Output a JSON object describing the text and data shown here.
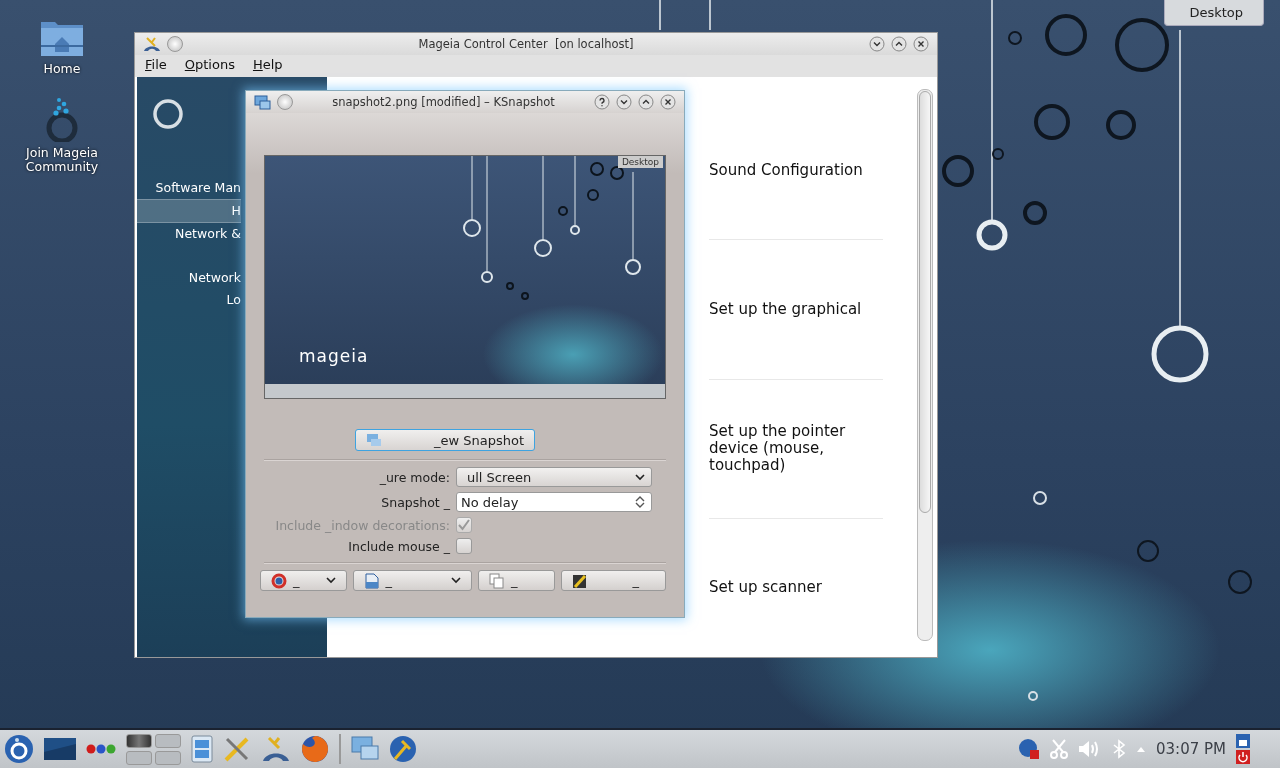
{
  "desktop_icons": [
    {
      "label": "Home",
      "kind": "folder"
    },
    {
      "label": "Join Mageia Community",
      "kind": "community"
    }
  ],
  "desktop_button": "Desktop",
  "control_center": {
    "title": "Mageia Control Center  [on localhost]",
    "menu": [
      "File",
      "Options",
      "Help"
    ],
    "sidebar": [
      {
        "label": "Software Man",
        "selected": false
      },
      {
        "label": "H",
        "selected": true
      },
      {
        "label": "Network &",
        "selected": false
      },
      {
        "label": "Network",
        "selected": false
      },
      {
        "label": "Lo",
        "selected": false
      }
    ],
    "items": [
      "Sound Configuration",
      "Set up the graphical",
      "Set up the pointer device (mouse, touchpad)",
      "Set up scanner"
    ]
  },
  "ksnapshot": {
    "title": "snapshot2.png [modified] – KSnapshot",
    "preview": {
      "desktop_button": "Desktop",
      "logo": "mageia"
    },
    "new_button": "_ew Snapshot",
    "mode_label": "_ure mode:",
    "mode_value": "ull Screen",
    "delay_label": "Snapshot _",
    "delay_value": "No delay",
    "options": [
      {
        "label": "Include _indow decorations:",
        "checked": true,
        "disabled": true
      },
      {
        "label": "Include mouse _",
        "checked": false,
        "disabled": false
      }
    ],
    "buttons": [
      {
        "label": "_",
        "kind": "help",
        "dropdown": true
      },
      {
        "label": "_",
        "kind": "save",
        "dropdown": true
      },
      {
        "label": "_",
        "kind": "copy",
        "dropdown": false
      },
      {
        "label": "_",
        "kind": "quit",
        "dropdown": false
      }
    ]
  },
  "taskbar": {
    "pager": [
      {
        "selected": true
      },
      {
        "selected": false
      },
      {
        "selected": false
      },
      {
        "selected": false
      }
    ],
    "clock": "03:07 PM"
  }
}
